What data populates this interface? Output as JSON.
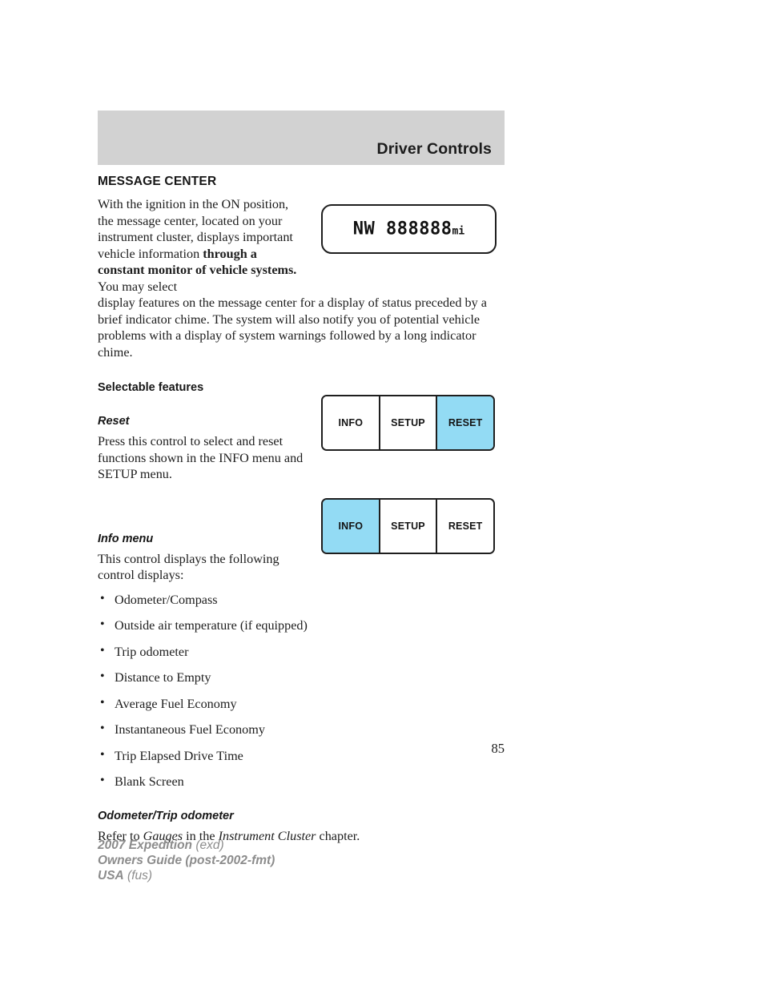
{
  "header": {
    "chapter_title": "Driver Controls",
    "band_color": "#d2d2d2"
  },
  "page_number": "85",
  "sections": {
    "message_center": {
      "heading": "MESSAGE CENTER",
      "intro_part1": "With the ignition in the ON position, the message center, located on your instrument cluster, displays important vehicle information ",
      "intro_bold": "through a constant monitor of vehicle systems.",
      "intro_part2": " You may select",
      "continuation": "display features on the message center for a display of status preceded by a brief indicator chime. The system will also notify you of potential vehicle problems with a display of system warnings followed by a long indicator chime."
    },
    "selectable_features": {
      "heading": "Selectable features"
    },
    "reset": {
      "heading": "Reset",
      "body": "Press this control to select and reset functions shown in the INFO menu and SETUP menu."
    },
    "info_menu": {
      "heading": "Info menu",
      "body": "This control displays the following control displays:",
      "items": [
        "Odometer/Compass",
        "Outside air temperature (if equipped)",
        "Trip odometer",
        "Distance to Empty",
        "Average Fuel Economy",
        "Instantaneous Fuel Economy",
        "Trip Elapsed Drive Time",
        "Blank Screen"
      ]
    },
    "odometer_trip": {
      "heading": "Odometer/Trip odometer",
      "body_prefix": "Refer to ",
      "body_italic1": "Gauges",
      "body_middle": " in the ",
      "body_italic2": "Instrument Cluster",
      "body_suffix": " chapter."
    }
  },
  "figures": {
    "lcd_display": {
      "compass": "NW",
      "odometer": "888888",
      "unit": "mi",
      "full_text": "NW 888888mi"
    },
    "button_group_reset": {
      "buttons": [
        {
          "label": "INFO",
          "active": false
        },
        {
          "label": "SETUP",
          "active": false
        },
        {
          "label": "RESET",
          "active": true
        }
      ],
      "highlight_color": "#93dbf4"
    },
    "button_group_info": {
      "buttons": [
        {
          "label": "INFO",
          "active": true
        },
        {
          "label": "SETUP",
          "active": false
        },
        {
          "label": "RESET",
          "active": false
        }
      ],
      "highlight_color": "#93dbf4"
    }
  },
  "footer": {
    "line1_strong": "2007 Expedition",
    "line1_light": " (exd)",
    "line2_strong": "Owners Guide (post-2002-fmt)",
    "line3_strong": "USA",
    "line3_light": " (fus)"
  }
}
